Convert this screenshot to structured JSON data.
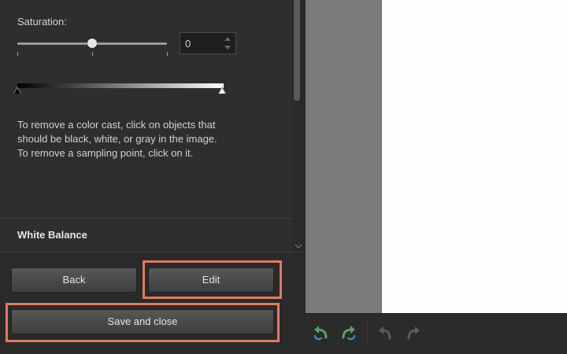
{
  "saturation": {
    "label": "Saturation:",
    "value": "0",
    "slider_fraction": 0.5
  },
  "help_text": "To remove a color cast, click on objects that should be black, white, or gray in the image. To remove a sampling point, click on it.",
  "section_title": "White Balance",
  "buttons": {
    "back": "Back",
    "edit": "Edit",
    "save_close": "Save and close"
  },
  "colors": {
    "highlight": "#e07a5f",
    "undo_redo_arrow": "#5aa06a"
  },
  "toolbar_icons": [
    "undo-all-icon",
    "redo-all-icon",
    "undo-icon",
    "redo-icon"
  ]
}
